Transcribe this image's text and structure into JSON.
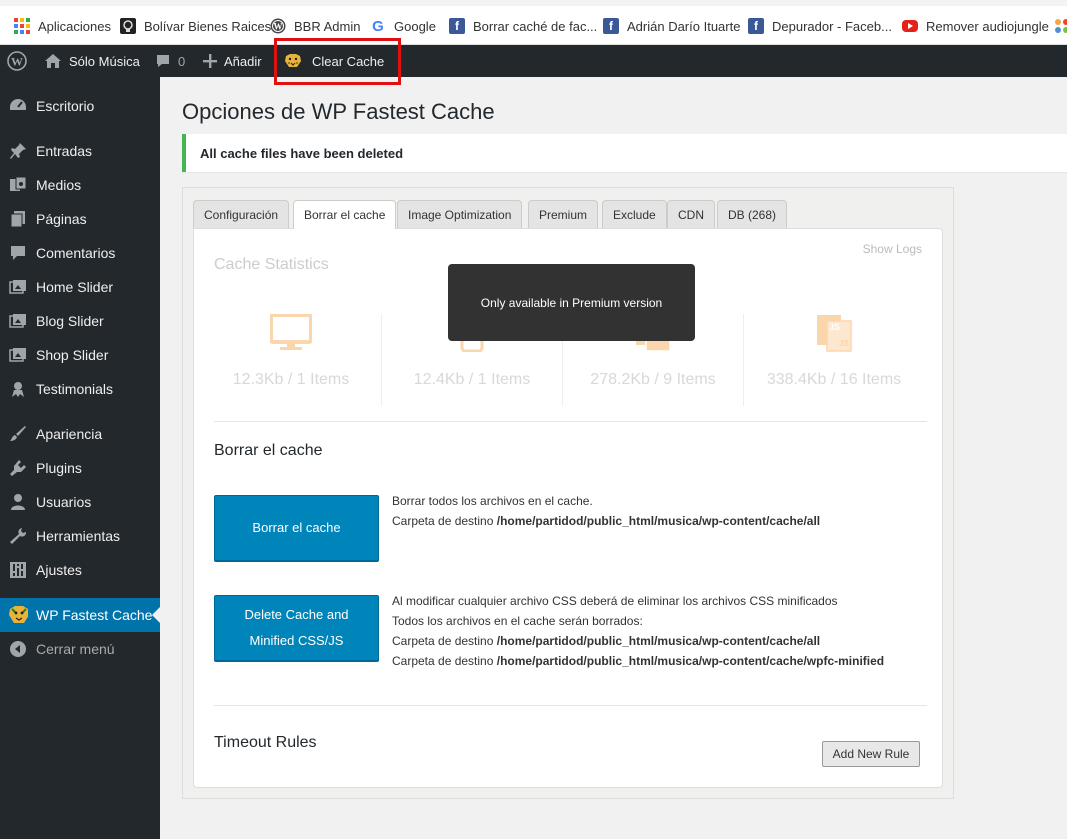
{
  "bookmarks": [
    {
      "label": "Aplicaciones",
      "icon": "apps-grid-icon"
    },
    {
      "label": "Bolívar Bienes Raices",
      "icon": "site-icon"
    },
    {
      "label": "BBR Admin",
      "icon": "wordpress-icon"
    },
    {
      "label": "Google",
      "icon": "google-icon"
    },
    {
      "label": "Borrar caché de fac...",
      "icon": "facebook-icon"
    },
    {
      "label": "Adrián Darío Ituarte",
      "icon": "facebook-icon"
    },
    {
      "label": "Depurador - Faceb...",
      "icon": "facebook-icon"
    },
    {
      "label": "Remover audiojungle",
      "icon": "youtube-icon"
    }
  ],
  "adminbar": {
    "site_name": "Sólo Música",
    "comments_count": "0",
    "add_label": "Añadir",
    "clear_cache_label": "Clear Cache"
  },
  "sidebar": {
    "items": [
      {
        "label": "Escritorio",
        "icon": "dashboard-icon"
      },
      {
        "label": "Entradas",
        "icon": "pin-icon"
      },
      {
        "label": "Medios",
        "icon": "media-icon"
      },
      {
        "label": "Páginas",
        "icon": "pages-icon"
      },
      {
        "label": "Comentarios",
        "icon": "comments-icon"
      },
      {
        "label": "Home Slider",
        "icon": "slider-icon"
      },
      {
        "label": "Blog Slider",
        "icon": "slider-icon"
      },
      {
        "label": "Shop Slider",
        "icon": "slider-icon"
      },
      {
        "label": "Testimonials",
        "icon": "testimonials-icon"
      },
      {
        "label": "Apariencia",
        "icon": "brush-icon"
      },
      {
        "label": "Plugins",
        "icon": "plugin-icon"
      },
      {
        "label": "Usuarios",
        "icon": "user-icon"
      },
      {
        "label": "Herramientas",
        "icon": "wrench-icon"
      },
      {
        "label": "Ajustes",
        "icon": "settings-icon"
      },
      {
        "label": "WP Fastest Cache",
        "icon": "cheetah-icon"
      },
      {
        "label": "Cerrar menú",
        "icon": "collapse-icon"
      }
    ]
  },
  "main": {
    "title": "Opciones de WP Fastest Cache",
    "notice": "All cache files have been deleted",
    "tabs": [
      {
        "label": "Configuración"
      },
      {
        "label": "Borrar el cache"
      },
      {
        "label": "Image Optimization"
      },
      {
        "label": "Premium"
      },
      {
        "label": "Exclude"
      },
      {
        "label": "CDN"
      },
      {
        "label": "DB (268)"
      }
    ],
    "show_logs": "Show Logs",
    "stats_title": "Cache Statistics",
    "stats": [
      {
        "value": "12.3Kb / 1 Items",
        "icon": "desktop-icon"
      },
      {
        "value": "12.4Kb / 1 Items",
        "icon": "mobile-icon"
      },
      {
        "value": "278.2Kb / 9 Items",
        "icon": "css-icon"
      },
      {
        "value": "338.4Kb / 16 Items",
        "icon": "js-icon"
      }
    ],
    "tooltip": "Only available in Premium version",
    "delete_section": {
      "title": "Borrar el cache",
      "btn1": "Borrar el cache",
      "btn1_line1": "Borrar todos los archivos en el cache.",
      "dest_label": "Carpeta de destino",
      "path_all": "/home/partidod/public_html/musica/wp-content/cache/all",
      "btn2_line1": "Delete Cache and",
      "btn2_line2": "Minified CSS/JS",
      "btn2_desc1": "Al modificar cualquier archivo CSS deberá de eliminar los archivos CSS minificados",
      "btn2_desc2": "Todos los archivos en el cache serán borrados:",
      "path_minified": "/home/partidod/public_html/musica/wp-content/cache/wpfc-minified"
    },
    "timeout": {
      "title": "Timeout Rules",
      "add_rule": "Add New Rule"
    }
  },
  "colors": {
    "admin_dark": "#23282d",
    "wp_blue": "#0073aa",
    "button_blue": "#0085ba",
    "notice_green": "#46b450",
    "stat_icon_orange": "#fbd6ac",
    "highlight_red": "#e01010"
  }
}
